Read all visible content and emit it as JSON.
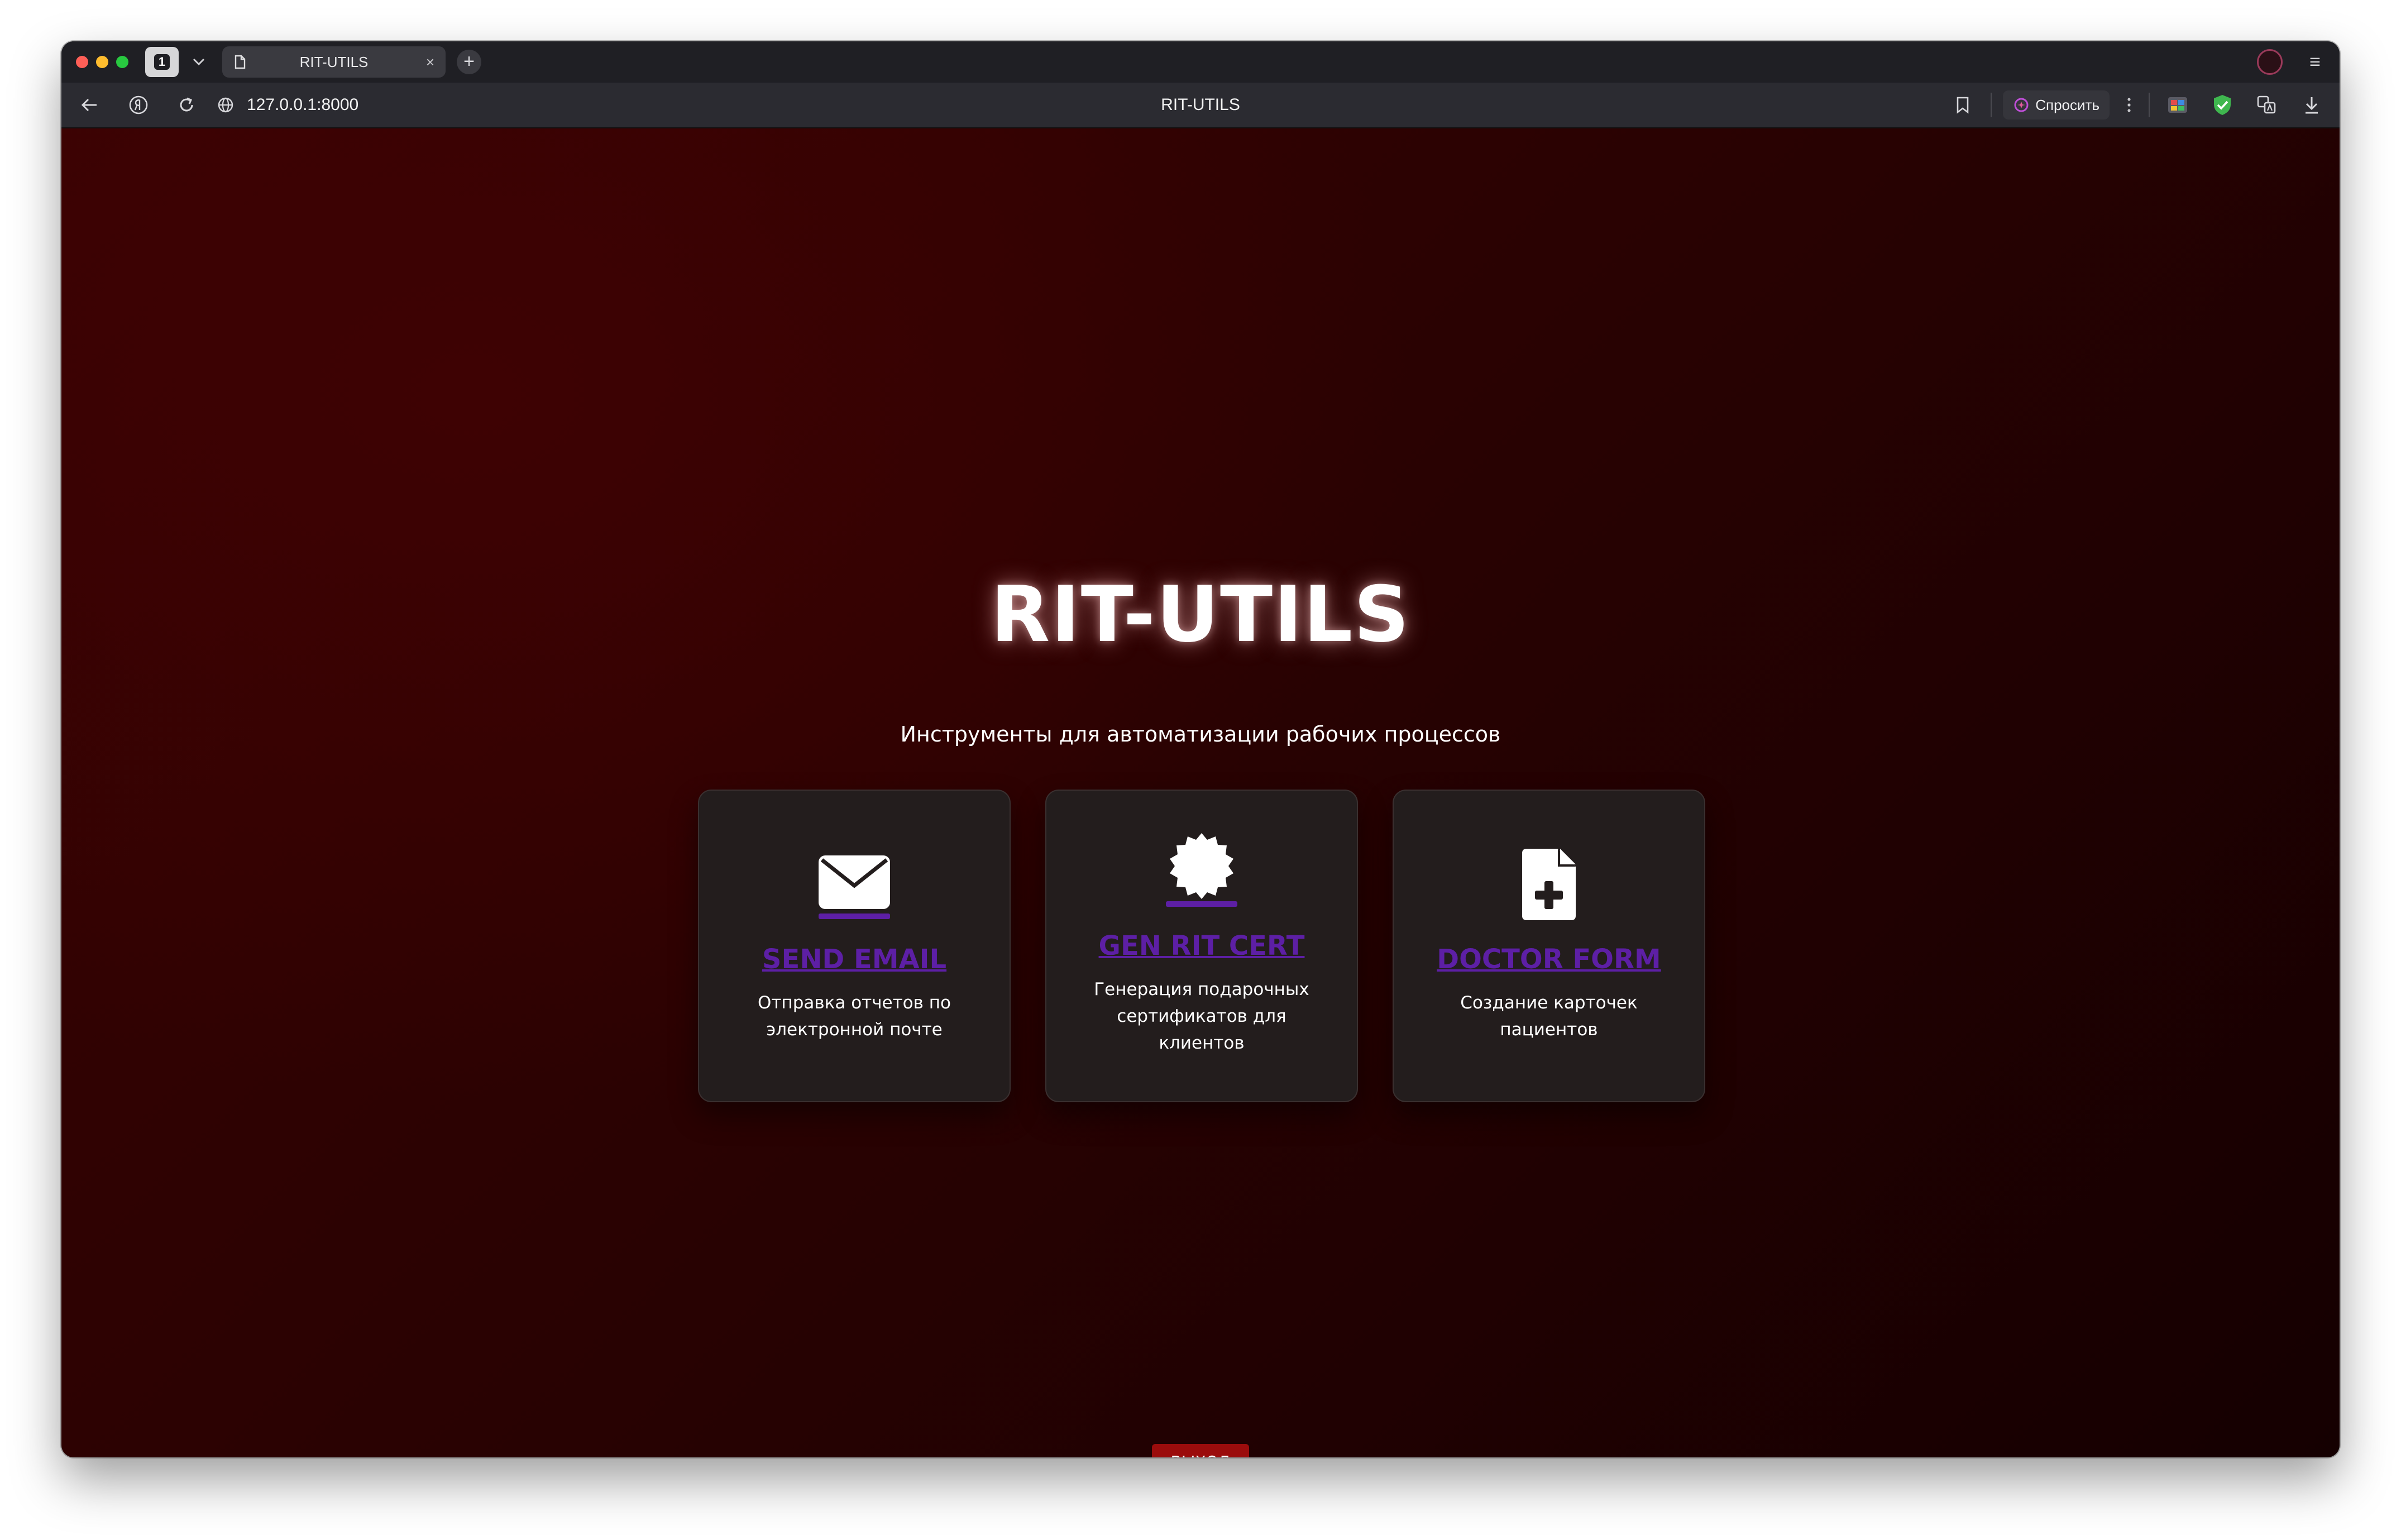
{
  "browser": {
    "tab_count": "1",
    "tab_title": "RIT-UTILS",
    "tab_close": "×",
    "new_tab": "+",
    "url": "127.0.0.1:8000",
    "page_title": "RIT-UTILS",
    "ask_label": "Спросить",
    "menu_glyph": "≡"
  },
  "page": {
    "title": "RIT-UTILS",
    "subtitle": "Инструменты для автоматизации рабочих процессов",
    "cards": [
      {
        "icon": "envelope-icon",
        "title": "SEND EMAIL",
        "description": "Отправка отчетов по электронной почте"
      },
      {
        "icon": "certificate-badge-icon",
        "title": "GEN RIT CERT",
        "description": "Генерация подарочных сертификатов для клиентов"
      },
      {
        "icon": "file-medical-icon",
        "title": "DOCTOR FORM",
        "description": "Создание карточек пациентов"
      }
    ],
    "logout_label": "ВЫХОД"
  },
  "colors": {
    "background_dark_red": "#3a0303",
    "card_bg": "#231d1d",
    "link_purple": "#5d1fa5",
    "logout_red": "#9b0c0c"
  }
}
